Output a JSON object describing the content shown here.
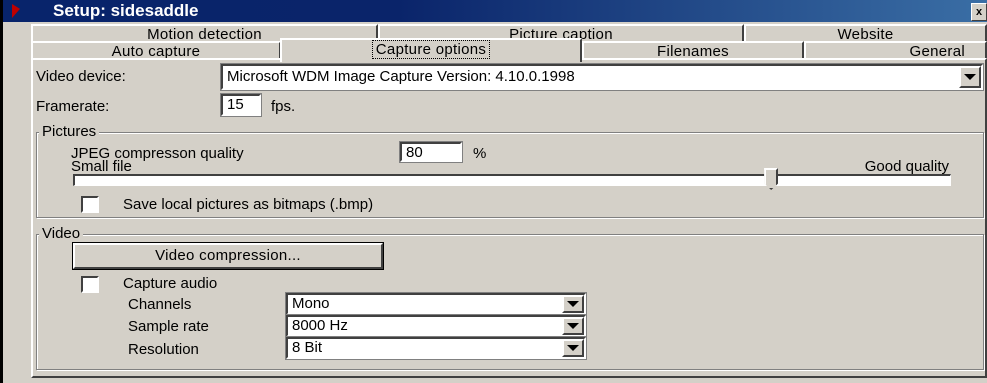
{
  "window": {
    "title": "Setup: sidesaddle",
    "close_label": "x"
  },
  "tabs": {
    "row1": [
      "Motion detection",
      "Picture caption",
      "Website"
    ],
    "row2": [
      "Auto capture",
      "Capture options",
      "Filenames",
      "General"
    ],
    "active": "Capture options"
  },
  "video_device": {
    "label": "Video device:",
    "value": "Microsoft WDM Image Capture Version:  4.10.0.1998"
  },
  "framerate": {
    "label": "Framerate:",
    "value": "15",
    "unit": "fps."
  },
  "pictures": {
    "group_label": "Pictures",
    "jpeg_label": "JPEG compresson quality",
    "jpeg_value": "80",
    "jpeg_unit": "%",
    "slider_min_label": "Small file",
    "slider_max_label": "Good quality",
    "slider_position": 0.8,
    "save_bmp_label": "Save local pictures as bitmaps (.bmp)",
    "save_bmp_checked": false
  },
  "video": {
    "group_label": "Video",
    "compression_button": "Video compression...",
    "capture_audio_label": "Capture audio",
    "capture_audio_checked": false,
    "channels_label": "Channels",
    "channels_value": "Mono",
    "sample_rate_label": "Sample rate",
    "sample_rate_value": "8000 Hz",
    "resolution_label": "Resolution",
    "resolution_value": "8 Bit"
  }
}
